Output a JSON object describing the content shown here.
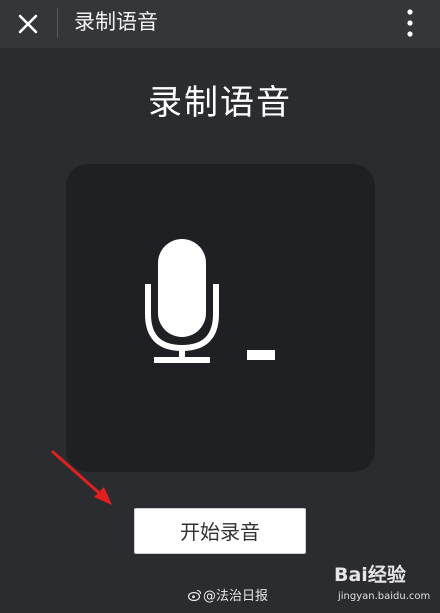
{
  "topbar": {
    "title": "录制语音",
    "close_icon": "close-icon",
    "more_icon": "more-vertical-icon"
  },
  "main": {
    "heading": "录制语音",
    "mic_icon": "microphone-icon",
    "cursor_icon": "text-cursor-icon",
    "start_button_label": "开始录音"
  },
  "footer": {
    "source_text": "@法治日报",
    "source_icon": "weibo-icon"
  },
  "watermark": {
    "logo_text": "Bai经验",
    "url": "jingyan.baidu.com"
  },
  "colors": {
    "background": "#2b2c2f",
    "topbar": "#35363a",
    "panel": "#1f2023",
    "annotation_arrow": "#e02020",
    "button": "#ffffff"
  }
}
